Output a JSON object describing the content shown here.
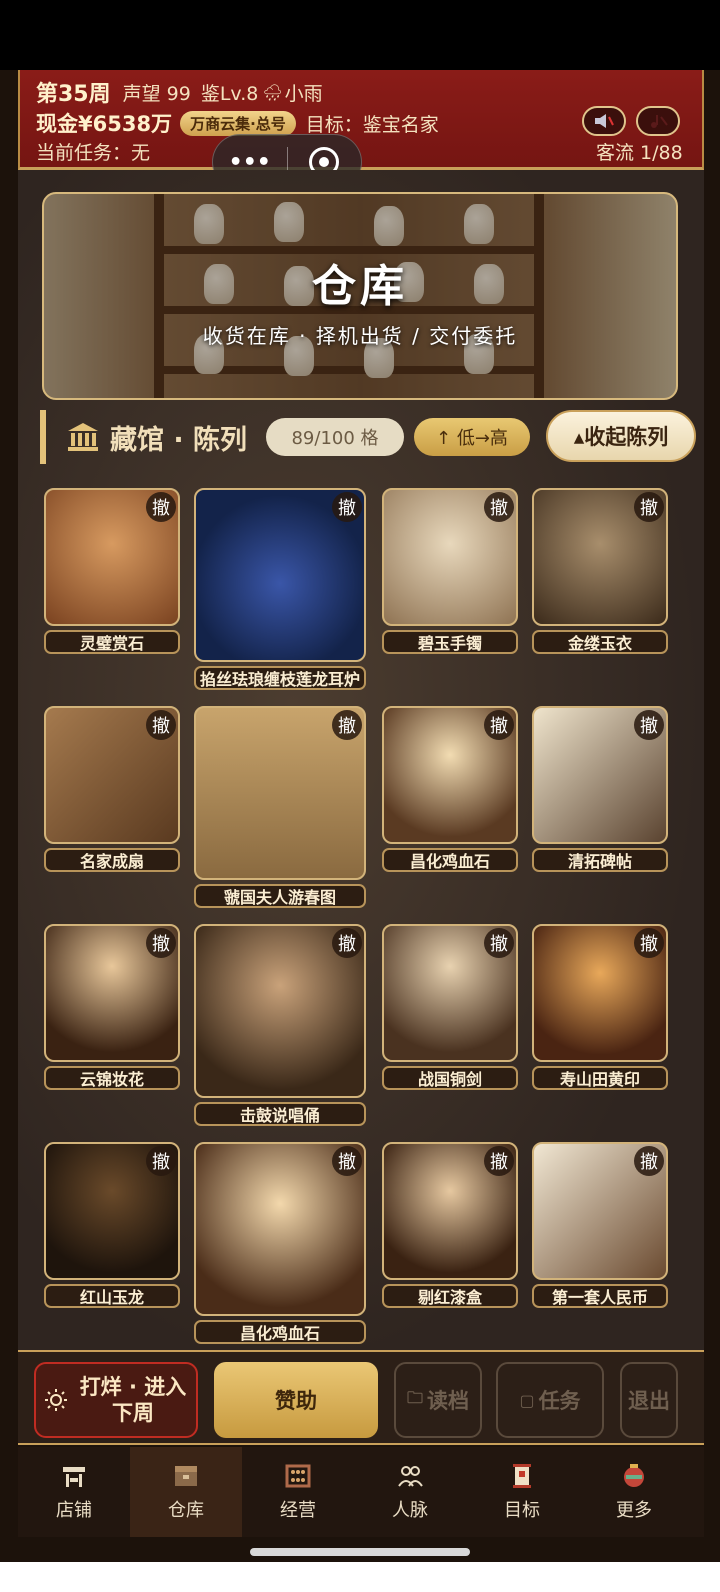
{
  "hud": {
    "week": "第35周",
    "reputation": "声望 99",
    "level": "鉴Lv.8",
    "weather": "小雨",
    "cash": "现金¥6538万",
    "tag": "万商云集·总号",
    "goal": "目标：鉴宝名家",
    "task": "当前任务：无",
    "traffic": "客流 1/88"
  },
  "capsule": {
    "more": "•••"
  },
  "banner": {
    "title": "仓库",
    "subtitle": "收货在库 · 择机出货 / 交付委托"
  },
  "section": {
    "title": "藏馆 · 陈列",
    "count": "89/100 格",
    "sort": "↑ 低→高",
    "collapse": "▴收起陈列"
  },
  "items": [
    {
      "name": "灵璧赏石",
      "remove": "撤"
    },
    {
      "name": "掐丝珐琅缠枝莲龙耳炉",
      "remove": "撤"
    },
    {
      "name": "碧玉手镯",
      "remove": "撤"
    },
    {
      "name": "金缕玉衣",
      "remove": "撤"
    },
    {
      "name": "名家成扇",
      "remove": "撤"
    },
    {
      "name": "虢国夫人游春图",
      "remove": "撤"
    },
    {
      "name": "昌化鸡血石",
      "remove": "撤"
    },
    {
      "name": "清拓碑帖",
      "remove": "撤"
    },
    {
      "name": "云锦妆花",
      "remove": "撤"
    },
    {
      "name": "击鼓说唱俑",
      "remove": "撤"
    },
    {
      "name": "战国铜剑",
      "remove": "撤"
    },
    {
      "name": "寿山田黄印",
      "remove": "撤"
    },
    {
      "name": "红山玉龙",
      "remove": "撤"
    },
    {
      "name": "昌化鸡血石",
      "remove": "撤"
    },
    {
      "name": "剔红漆盒",
      "remove": "撤"
    },
    {
      "name": "第一套人民币",
      "remove": "撤"
    }
  ],
  "actions": {
    "next_week": "打烊 · 进入下周",
    "sponsor": "赞助",
    "read_save": "读档",
    "tasks": "任务",
    "exit": "退出"
  },
  "tabs": [
    "店铺",
    "仓库",
    "经营",
    "人脉",
    "目标",
    "更多"
  ],
  "colors": {
    "hud_red": "#8a1c18",
    "gold": "#c9a05a",
    "dark": "#1c120b"
  }
}
